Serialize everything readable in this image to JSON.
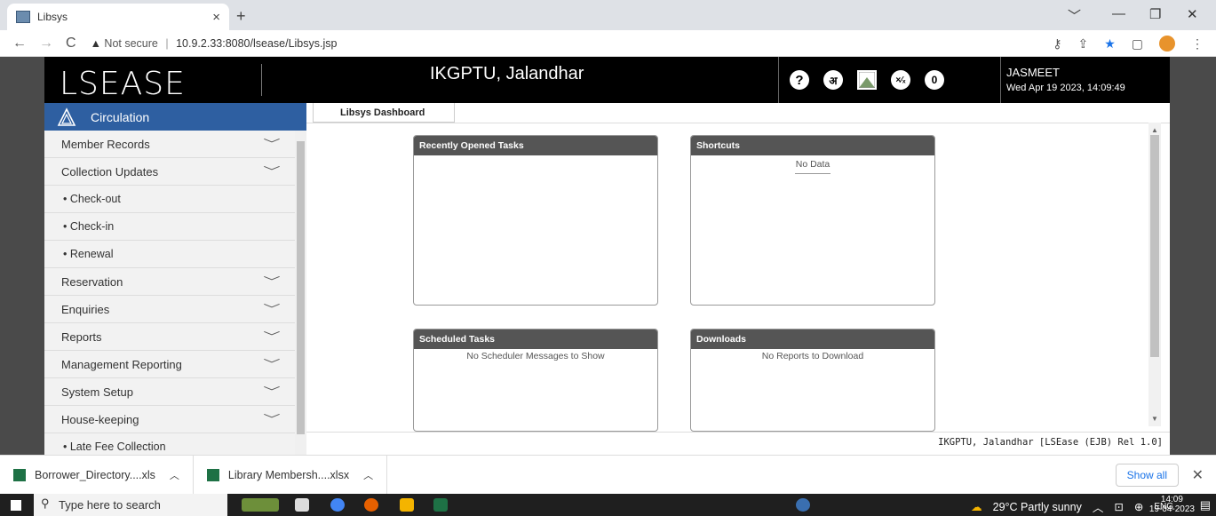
{
  "browser": {
    "tab_title": "Libsys",
    "tab_close": "×",
    "new_tab": "+",
    "win_controls": [
      "﹀",
      "—",
      "❐",
      "✕"
    ],
    "nav": {
      "back": "←",
      "forward": "→",
      "reload": "C"
    },
    "url_warning": "Not secure",
    "url": "10.9.2.33:8080/lsease/Libsys.jsp"
  },
  "header": {
    "logo": "LSEASE",
    "org": "IKGPTU, Jalandhar",
    "icons": [
      "help-icon",
      "hindi-keyboard-icon",
      "image-icon",
      "calculator-icon"
    ],
    "notification_count": "0",
    "user": "JASMEET",
    "datetime": "Wed Apr 19 2023, 14:09:49"
  },
  "sidebar": {
    "title": "Circulation",
    "items": [
      {
        "label": "Member Records",
        "type": "group"
      },
      {
        "label": "Collection Updates",
        "type": "group"
      },
      {
        "label": "• Check-out",
        "type": "sub"
      },
      {
        "label": "• Check-in",
        "type": "sub"
      },
      {
        "label": "• Renewal",
        "type": "sub"
      },
      {
        "label": "Reservation",
        "type": "group"
      },
      {
        "label": "Enquiries",
        "type": "group"
      },
      {
        "label": "Reports",
        "type": "group"
      },
      {
        "label": "Management Reporting",
        "type": "group"
      },
      {
        "label": "System Setup",
        "type": "group"
      },
      {
        "label": "House-keeping",
        "type": "group"
      },
      {
        "label": "• Late Fee Collection",
        "type": "sub"
      }
    ]
  },
  "content": {
    "tab": "Libsys Dashboard",
    "panels": [
      {
        "title": "Recently Opened Tasks",
        "message": ""
      },
      {
        "title": "Shortcuts",
        "message": "No Data"
      },
      {
        "title": "Scheduled Tasks",
        "message": "No Scheduler Messages to Show"
      },
      {
        "title": "Downloads",
        "message": "No Reports to Download"
      }
    ],
    "footer": "IKGPTU, Jalandhar [LSEase (EJB) Rel 1.0]"
  },
  "downloads": {
    "items": [
      "Borrower_Directory....xls",
      "Library Membersh....xlsx"
    ],
    "show_all": "Show all"
  },
  "taskbar": {
    "search_placeholder": "Type here to search",
    "weather": "29°C  Partly sunny",
    "lang": "ENG",
    "time": "14:09",
    "date": "19-04-2023"
  }
}
